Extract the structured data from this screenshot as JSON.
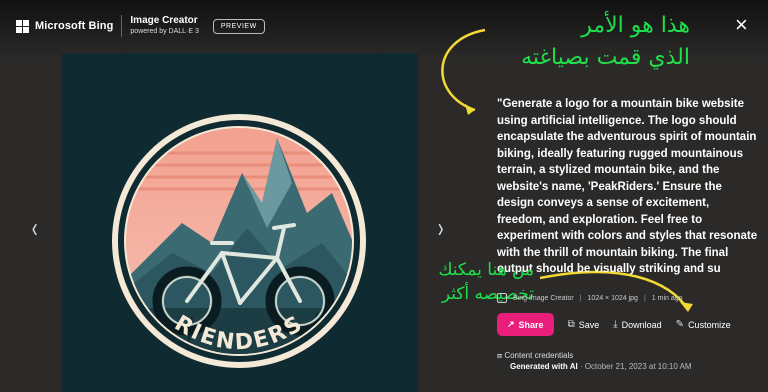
{
  "header": {
    "brand": "Microsoft Bing",
    "product_title": "Image Creator",
    "product_sub": "powered by DALL·E 3",
    "badge": "PREVIEW"
  },
  "close_icon": "×",
  "nav": {
    "prev": "‹",
    "next": "›"
  },
  "image": {
    "logo_text": "RIENDERS"
  },
  "annotations": {
    "top_line1": "هذا هو الأمر",
    "top_line2": "الذي قمت بصياغته",
    "mid_line1": "من هنا يمكنك",
    "mid_line2": "تخصيصه أكثر",
    "color": "#1fe04b"
  },
  "prompt": "\"Generate a logo for a mountain bike website using artificial intelligence. The logo should encapsulate the adventurous spirit of mountain biking, ideally featuring rugged mountainous terrain, a stylized mountain bike, and the website's name, 'PeakRiders.' Ensure the design conveys a sense of excitement, freedom, and exploration. Feel free to experiment with colors and styles that resonate with the thrill of mountain biking. The final output should be visually striking and su",
  "meta": {
    "source": "Bing Image Creator",
    "dimensions": "1024 × 1024 jpg",
    "age": "1 min ago"
  },
  "actions": {
    "share": "Share",
    "save": "Save",
    "download": "Download",
    "customize": "Customize",
    "share_color": "#e91e7a"
  },
  "credentials": {
    "title": "Content credentials",
    "generated": "Generated with AI",
    "date": "October 21, 2023 at 10:10 AM"
  }
}
